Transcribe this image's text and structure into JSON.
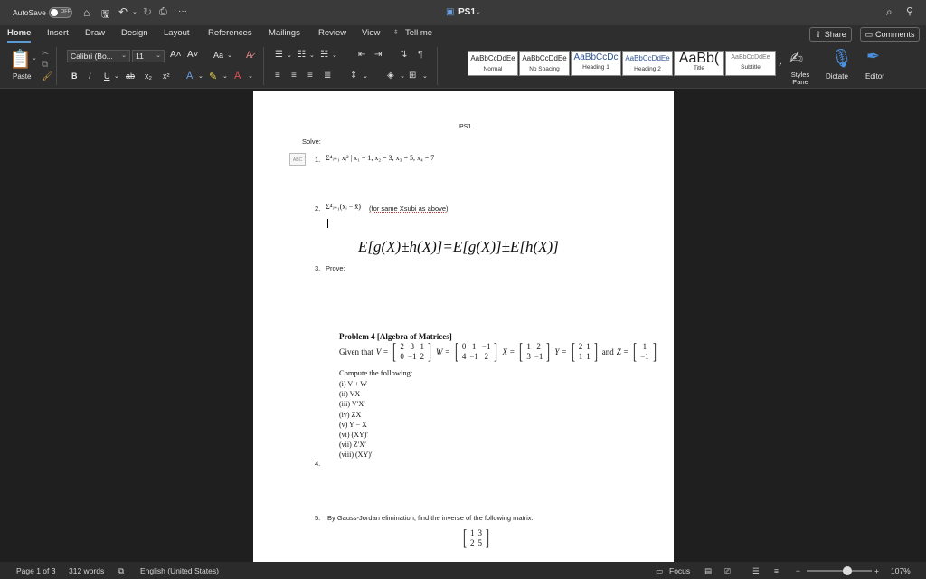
{
  "titlebar": {
    "autosave_label": "AutoSave",
    "autosave_state": "OFF",
    "doc_title": "PS1",
    "more": "···"
  },
  "tabs": [
    "Home",
    "Insert",
    "Draw",
    "Design",
    "Layout",
    "References",
    "Mailings",
    "Review",
    "View"
  ],
  "tell_me": "Tell me",
  "share_label": "Share",
  "comments_label": "Comments",
  "ribbon": {
    "paste_label": "Paste",
    "font_name": "Calibri (Bo...",
    "font_size": "11",
    "bold": "B",
    "italic": "I",
    "underline": "U",
    "strike": "ab",
    "subscript": "x₂",
    "superscript": "x²",
    "grow": "A˄",
    "shrink": "A˅",
    "case": "Aa",
    "styles": [
      {
        "sample": "AaBbCcDdEe",
        "label": "Normal"
      },
      {
        "sample": "AaBbCcDdEe",
        "label": "No Spacing"
      },
      {
        "sample": "AaBbCcDc",
        "label": "Heading 1"
      },
      {
        "sample": "AaBbCcDdEe",
        "label": "Heading 2"
      },
      {
        "sample": "AaBb(",
        "label": "Title"
      },
      {
        "sample": "AaBbCcDdEe",
        "label": "Subtitle"
      }
    ],
    "styles_pane": "Styles Pane",
    "dictate": "Dictate",
    "editor": "Editor"
  },
  "document": {
    "header": "PS1",
    "solve": "Solve:",
    "item1_num": "1.",
    "item1_expr": "Σ⁴ᵢ₌₁ xᵢ² | x₁ = 1, x₂ = 3, x₃ = 5, x₄ = 7",
    "item2_num": "2.",
    "item2_expr": "Σ⁴ᵢ₌₁(xᵢ − x̄)",
    "item2_note": "(for same Xsubi as above)",
    "equation": "E[g(X)±h(X)]=E[g(X)]±E[h(X)]",
    "item3_num": "3.",
    "item3_text": "Prove:",
    "problem_title": "Problem 4 [Algebra of Matrices]",
    "given_prefix": "Given that",
    "V": {
      "name": "V =",
      "rows": [
        [
          "2",
          "3",
          "1"
        ],
        [
          "0",
          "−1",
          "2"
        ]
      ]
    },
    "W": {
      "name": "W =",
      "rows": [
        [
          "0",
          "1",
          "−1"
        ],
        [
          "4",
          "−1",
          "2"
        ]
      ]
    },
    "X": {
      "name": "X =",
      "rows": [
        [
          "1",
          "2"
        ],
        [
          "3",
          "−1"
        ]
      ]
    },
    "Y": {
      "name": "Y =",
      "rows": [
        [
          "2",
          "1"
        ],
        [
          "1",
          "1"
        ]
      ]
    },
    "Z": {
      "name": "Z =",
      "rows": [
        [
          "1"
        ],
        [
          "−1"
        ]
      ]
    },
    "and_text": "and",
    "compute": "Compute the following:",
    "compute_items": [
      "(i) V + W",
      "(ii) VX",
      "(iii) V′X′",
      "(iv) ZX",
      "(v) Y − X",
      "(vi) (XY)′",
      "(vii) Z′X′",
      "(viii) (XY)′"
    ],
    "item4_num": "4.",
    "item5_num": "5.",
    "item5_text": "By Gauss-Jordan elimination, find the inverse of the following matrix:",
    "final_matrix": [
      [
        "1",
        "3"
      ],
      [
        "2",
        "5"
      ]
    ]
  },
  "status": {
    "page": "Page 1 of 3",
    "words": "312 words",
    "language": "English (United States)",
    "focus": "Focus",
    "zoom": "107%",
    "zoom_level": 0.62
  }
}
